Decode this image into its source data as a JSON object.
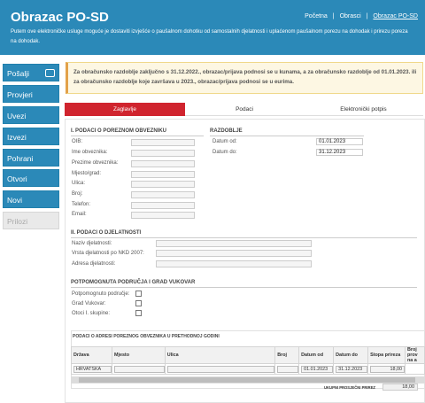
{
  "header": {
    "title": "Obrazac PO-SD",
    "breadcrumb": [
      "Početna",
      "Obrasci",
      "Obrazac PO-SD"
    ],
    "description": "Putem ove elektroničke usluge moguće je dostaviti izvješće o paušalnom dohotku od samostalnih djelatnosti i uplaćenom paušalnom porezu na dohodak i prirezu poreza na dohodak."
  },
  "sidebar": {
    "items": [
      {
        "label": "Pošalji",
        "icon": "send-icon"
      },
      {
        "label": "Provjeri"
      },
      {
        "label": "Uvezi"
      },
      {
        "label": "Izvezi"
      },
      {
        "label": "Pohrani"
      },
      {
        "label": "Otvori"
      },
      {
        "label": "Novi"
      },
      {
        "label": "Prilozi",
        "disabled": true
      }
    ]
  },
  "notice": "Za obračunsko razdoblje zaključno s 31.12.2022., obrazac/prijava podnosi se u kunama, a za obračunsko razdoblje od 01.01.2023. ili za obračunsko razdoblje koje završava u 2023., obrazac/prijava podnosi se u eurima.",
  "tabs": [
    "Zaglavlje",
    "Podaci",
    "Elektronički potpis"
  ],
  "section1": {
    "title": "I. PODACI O POREZNOM OBVEZNIKU",
    "fields": [
      "OIB:",
      "Ime obveznika:",
      "Prezime obveznika:",
      "Mjesto/grad:",
      "Ulica:",
      "Broj:",
      "Telefon:",
      "Email:"
    ]
  },
  "razdoblje": {
    "title": "RAZDOBLJE",
    "from_label": "Datum od:",
    "from_value": "01.01.2023",
    "to_label": "Datum do:",
    "to_value": "31.12.2023"
  },
  "section2": {
    "title": "II. PODACI O DJELATNOSTI",
    "fields": [
      "Naziv djelatnosti:",
      "Vrsta djelatnosti po NKD 2007:",
      "Adresa djelatnosti:"
    ]
  },
  "section3": {
    "title": "POTPOMOGNUTA PODRUČJA I GRAD VUKOVAR",
    "checks": [
      "Potpomognuto područje:",
      "Grad Vukovar:",
      "Otoci I. skupine:"
    ]
  },
  "address_table": {
    "title": "PODACI O ADRESI POREZNOG OBVEZNIKA U PRETHODNOJ GODINI",
    "headers": [
      "Država",
      "Mjesto",
      "Ulica",
      "Broj",
      "Datum od",
      "Datum do",
      "Stopa prireza",
      "Broj prov na a"
    ],
    "row": {
      "drzava": "HRVATSKA",
      "datum_od": "01.01.2023",
      "datum_do": "31.12.2023",
      "stopa": "18,00"
    },
    "sum_label": "UKUPNI PROSJEČNI PRIREZ",
    "sum_value": "18,00"
  }
}
